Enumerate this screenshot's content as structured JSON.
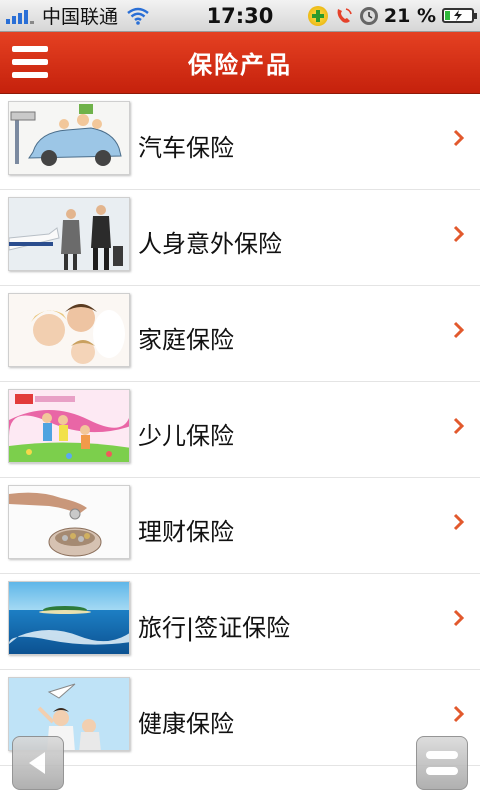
{
  "status_bar": {
    "carrier": "中国联通",
    "time": "17:30",
    "battery_percent": "21 %",
    "battery_level": 0.21,
    "icons": [
      "signal-icon",
      "wifi-icon",
      "360-security-icon",
      "phone-call-icon",
      "alarm-icon",
      "battery-charging-icon"
    ]
  },
  "header": {
    "title": "保险产品",
    "menu_icon": "hamburger-menu-icon"
  },
  "colors": {
    "header": "#d5301a",
    "chevron": "#e2592d",
    "signal": "#2a6fd6",
    "battery": "#2db83a"
  },
  "products": [
    {
      "label": "汽车保险",
      "thumb": "family-car-illustration"
    },
    {
      "label": "人身意外保险",
      "thumb": "business-travelers-plane"
    },
    {
      "label": "家庭保险",
      "thumb": "family-portrait"
    },
    {
      "label": "少儿保险",
      "thumb": "children-playing-illustration"
    },
    {
      "label": "理财保险",
      "thumb": "coin-piggy-bank"
    },
    {
      "label": "旅行|签证保险",
      "thumb": "island-ocean"
    },
    {
      "label": "健康保险",
      "thumb": "mother-child-paper-plane"
    }
  ],
  "bottom": {
    "back_icon": "back-arrow-icon",
    "menu_icon": "menu-icon"
  }
}
